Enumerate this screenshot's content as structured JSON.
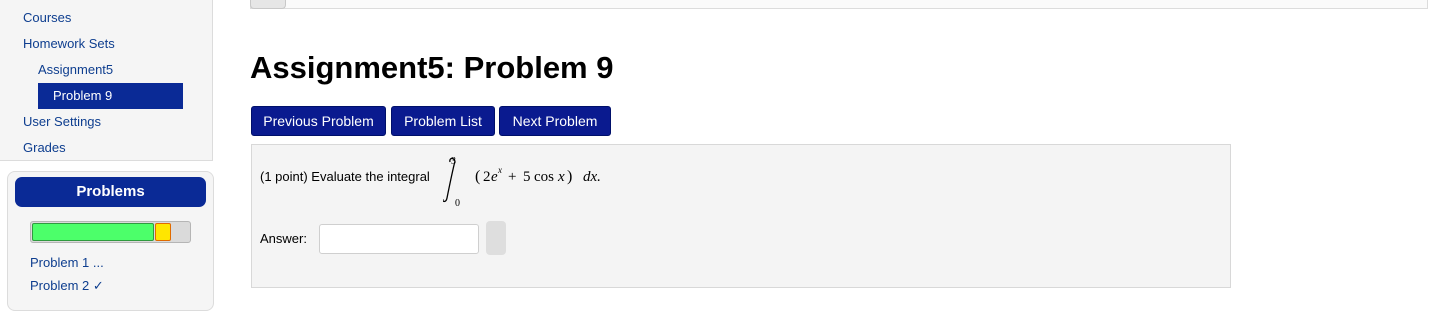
{
  "sidebar": {
    "courses": "Courses",
    "homework_sets": "Homework Sets",
    "assignment": "Assignment5",
    "current_problem": "Problem 9",
    "user_settings": "User Settings",
    "grades": "Grades"
  },
  "problems_panel": {
    "title": "Problems",
    "progress": {
      "correct_fraction": 0.78,
      "partial_fraction": 0.1
    },
    "items": [
      "Problem 1 ...",
      "Problem 2 ✓"
    ]
  },
  "page": {
    "title": "Assignment5: Problem 9"
  },
  "nav_buttons": {
    "previous": "Previous Problem",
    "list": "Problem List",
    "next": "Next Problem"
  },
  "problem": {
    "intro": "(1 point) Evaluate the integral",
    "integral": {
      "lower": "0",
      "upper": "3",
      "open_paren": "(",
      "coef1": "2",
      "base": "e",
      "exponent": "x",
      "plus": "+",
      "coef2": "5",
      "func": "cos",
      "var": "x",
      "close_paren": ")",
      "differential": "dx."
    },
    "answer_label": "Answer:",
    "answer_value": ""
  },
  "colors": {
    "nav_blue": "#0a2a96",
    "button_blue": "#0a1a8f",
    "link_blue": "#0e3e8f",
    "progress_green": "#4cff6a",
    "progress_yellow": "#ffe600"
  }
}
